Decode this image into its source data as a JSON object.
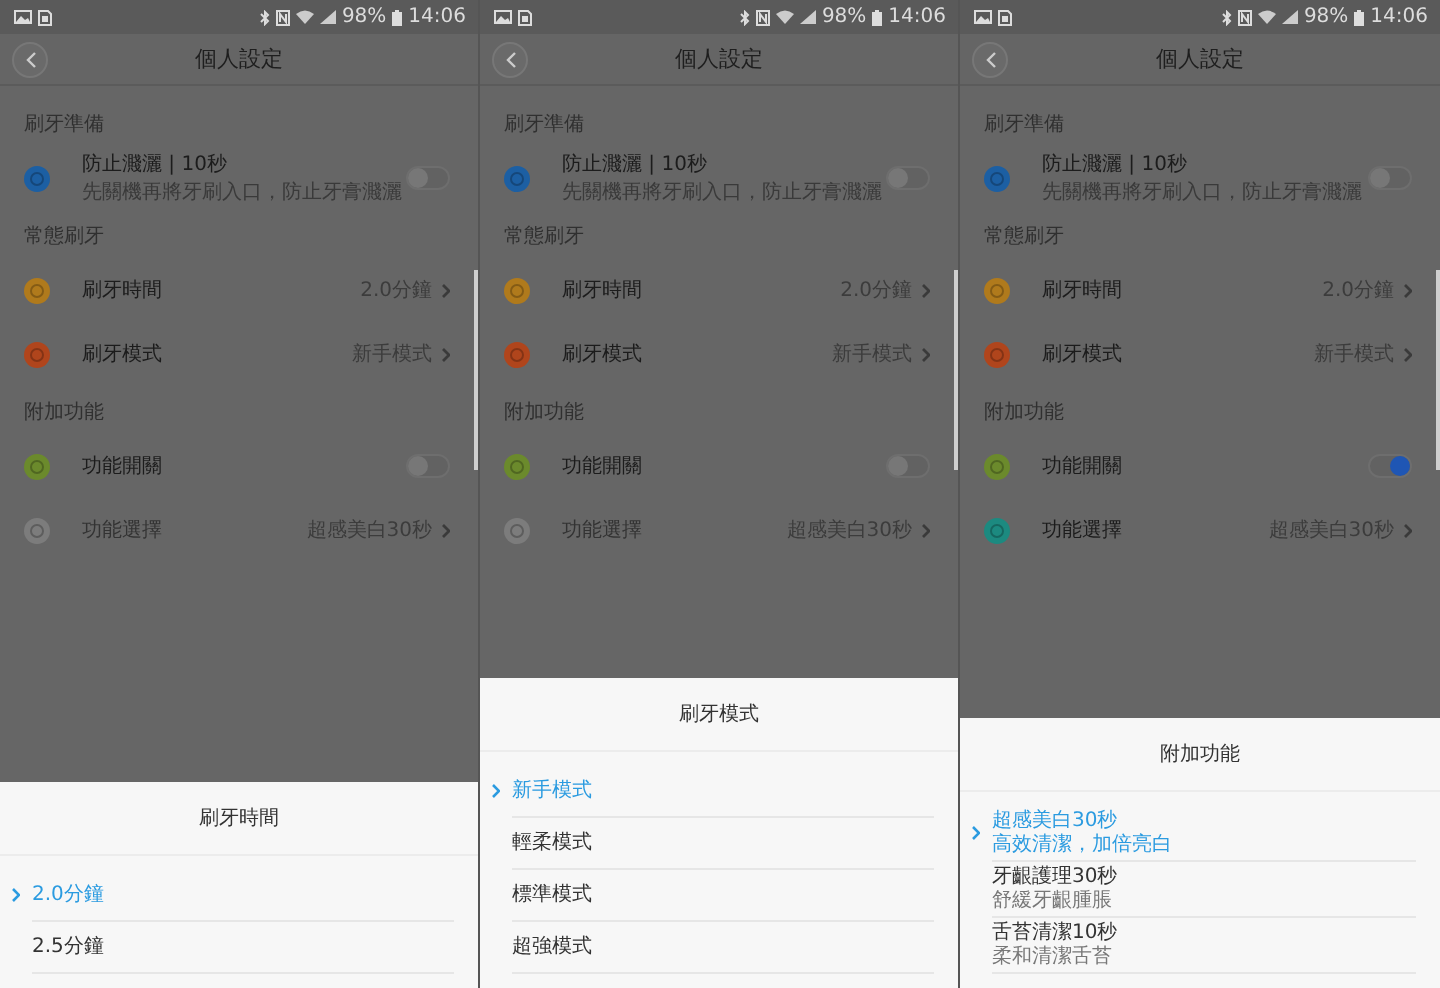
{
  "panels": [
    {
      "status_bar": {
        "battery": "98%",
        "time": "14:06"
      },
      "header": {
        "title": "個人設定"
      },
      "sections": [
        {
          "title": "刷牙準備",
          "items": [
            {
              "kind": "toggle",
              "color": "#1c5fa3",
              "title": "防止濺灑 | 10秒",
              "subtitle": "先關機再將牙刷入口，防止牙膏濺灑",
              "on": false,
              "disabled": false
            }
          ]
        },
        {
          "title": "常態刷牙",
          "items": [
            {
              "kind": "value",
              "color": "#b07a1c",
              "title": "刷牙時間",
              "value": "2.0分鐘",
              "disabled": false
            },
            {
              "kind": "value",
              "color": "#b0451c",
              "title": "刷牙模式",
              "value": "新手模式",
              "disabled": false
            }
          ]
        },
        {
          "title": "附加功能",
          "items": [
            {
              "kind": "toggle",
              "color": "#6b8a2c",
              "title": "功能開關",
              "on": false,
              "disabled": false
            },
            {
              "kind": "value",
              "color": "#7c7c7c",
              "title": "功能選擇",
              "value": "超感美白30秒",
              "disabled": true
            }
          ]
        }
      ],
      "sheet": {
        "title": "刷牙時間",
        "options": [
          {
            "label": "2.0分鐘",
            "selected": true
          },
          {
            "label": "2.5分鐘",
            "selected": false
          }
        ]
      }
    },
    {
      "status_bar": {
        "battery": "98%",
        "time": "14:06"
      },
      "header": {
        "title": "個人設定"
      },
      "sections": [
        {
          "title": "刷牙準備",
          "items": [
            {
              "kind": "toggle",
              "color": "#1c5fa3",
              "title": "防止濺灑 | 10秒",
              "subtitle": "先關機再將牙刷入口，防止牙膏濺灑",
              "on": false,
              "disabled": false
            }
          ]
        },
        {
          "title": "常態刷牙",
          "items": [
            {
              "kind": "value",
              "color": "#b07a1c",
              "title": "刷牙時間",
              "value": "2.0分鐘",
              "disabled": false
            },
            {
              "kind": "value",
              "color": "#b0451c",
              "title": "刷牙模式",
              "value": "新手模式",
              "disabled": false
            }
          ]
        },
        {
          "title": "附加功能",
          "items": [
            {
              "kind": "toggle",
              "color": "#6b8a2c",
              "title": "功能開關",
              "on": false,
              "disabled": false
            },
            {
              "kind": "value",
              "color": "#7c7c7c",
              "title": "功能選擇",
              "value": "超感美白30秒",
              "disabled": true
            }
          ]
        }
      ],
      "sheet": {
        "title": "刷牙模式",
        "options": [
          {
            "label": "新手模式",
            "selected": true
          },
          {
            "label": "輕柔模式",
            "selected": false
          },
          {
            "label": "標準模式",
            "selected": false
          },
          {
            "label": "超強模式",
            "selected": false
          }
        ]
      }
    },
    {
      "status_bar": {
        "battery": "98%",
        "time": "14:06"
      },
      "header": {
        "title": "個人設定"
      },
      "sections": [
        {
          "title": "刷牙準備",
          "items": [
            {
              "kind": "toggle",
              "color": "#1c5fa3",
              "title": "防止濺灑 | 10秒",
              "subtitle": "先關機再將牙刷入口，防止牙膏濺灑",
              "on": false,
              "disabled": false
            }
          ]
        },
        {
          "title": "常態刷牙",
          "items": [
            {
              "kind": "value",
              "color": "#b07a1c",
              "title": "刷牙時間",
              "value": "2.0分鐘",
              "disabled": false
            },
            {
              "kind": "value",
              "color": "#b0451c",
              "title": "刷牙模式",
              "value": "新手模式",
              "disabled": false
            }
          ]
        },
        {
          "title": "附加功能",
          "items": [
            {
              "kind": "toggle",
              "color": "#6b8a2c",
              "title": "功能開關",
              "on": true,
              "disabled": false
            },
            {
              "kind": "value",
              "color": "#1c8a80",
              "title": "功能選擇",
              "value": "超感美白30秒",
              "disabled": false
            }
          ]
        }
      ],
      "sheet": {
        "title": "附加功能",
        "options": [
          {
            "label": "超感美白30秒",
            "sublabel": "高效清潔，加倍亮白",
            "selected": true
          },
          {
            "label": "牙齦護理30秒",
            "sublabel": "舒緩牙齦腫脹",
            "selected": false
          },
          {
            "label": "舌苔清潔10秒",
            "sublabel": "柔和清潔舌苔",
            "selected": false
          }
        ]
      }
    }
  ]
}
